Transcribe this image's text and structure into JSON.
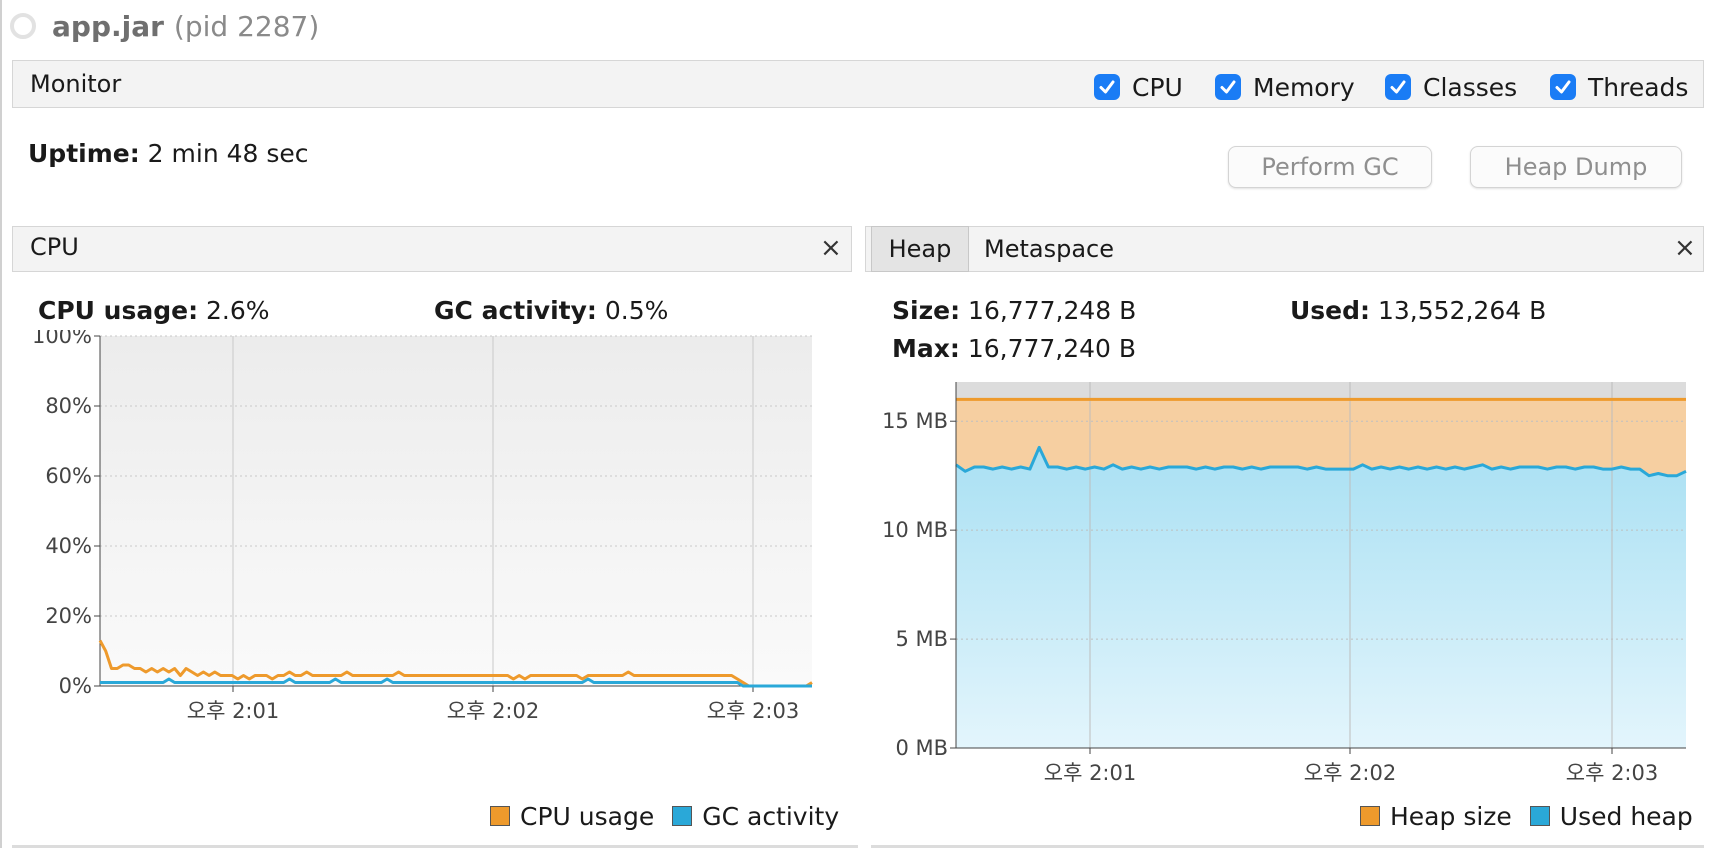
{
  "window": {
    "app_name": "app.jar",
    "pid_text": "(pid 2287)"
  },
  "monitor": {
    "title": "Monitor",
    "checkboxes": [
      {
        "label": "CPU",
        "checked": true
      },
      {
        "label": "Memory",
        "checked": true
      },
      {
        "label": "Classes",
        "checked": true
      },
      {
        "label": "Threads",
        "checked": true
      }
    ],
    "uptime_label": "Uptime:",
    "uptime_value": "2 min 48 sec",
    "perform_gc_label": "Perform GC",
    "heap_dump_label": "Heap Dump"
  },
  "cpu_panel": {
    "title": "CPU",
    "close": "×",
    "cpu_usage_label": "CPU usage:",
    "cpu_usage_value": "2.6%",
    "gc_activity_label": "GC activity:",
    "gc_activity_value": "0.5%",
    "legend": {
      "cpu": "CPU usage",
      "gc": "GC activity"
    }
  },
  "memory_panel": {
    "tabs": [
      "Heap",
      "Metaspace"
    ],
    "close": "×",
    "size_label": "Size:",
    "size_value": "16,777,248 B",
    "used_label": "Used:",
    "used_value": "13,552,264 B",
    "max_label": "Max:",
    "max_value": "16,777,240 B",
    "legend": {
      "heap_size": "Heap size",
      "used_heap": "Used heap"
    }
  },
  "colors": {
    "orange": "#ee9a2c",
    "blue": "#2aa8d8",
    "checkbox": "#1a7cf5"
  },
  "chart_data": [
    {
      "type": "line",
      "name": "CPU",
      "x_tick_labels": [
        "오후 2:01",
        "오후 2:02",
        "오후 2:03"
      ],
      "y_tick_labels": [
        "0%",
        "20%",
        "40%",
        "60%",
        "80%",
        "100%"
      ],
      "ylim": [
        0,
        100
      ],
      "grid": true,
      "legend_position": "bottom-right",
      "series": [
        {
          "name": "CPU usage",
          "color": "#ee9a2c",
          "values": [
            13,
            10,
            5,
            5,
            6,
            6,
            5,
            5,
            4,
            5,
            4,
            5,
            4,
            5,
            3,
            5,
            4,
            3,
            4,
            3,
            4,
            3,
            3,
            3,
            2,
            3,
            2,
            3,
            3,
            3,
            2,
            3,
            3,
            4,
            3,
            3,
            4,
            3,
            3,
            3,
            3,
            3,
            3,
            4,
            3,
            3,
            3,
            3,
            3,
            3,
            3,
            3,
            4,
            3,
            3,
            3,
            3,
            3,
            3,
            3,
            3,
            3,
            3,
            3,
            3,
            3,
            3,
            3,
            3,
            3,
            3,
            3,
            2,
            3,
            2,
            3,
            3,
            3,
            3,
            3,
            3,
            3,
            3,
            3,
            2,
            3,
            3,
            3,
            3,
            3,
            3,
            3,
            4,
            3,
            3,
            3,
            3,
            3,
            3,
            3,
            3,
            3,
            3,
            3,
            3,
            3,
            3,
            3,
            3,
            3,
            3,
            2,
            1,
            0,
            0,
            0,
            0,
            0,
            0,
            0,
            0,
            0,
            0,
            0,
            1
          ]
        },
        {
          "name": "GC activity",
          "color": "#2aa8d8",
          "values": [
            1,
            1,
            1,
            1,
            1,
            1,
            1,
            1,
            1,
            1,
            1,
            1,
            2,
            1,
            1,
            1,
            1,
            1,
            1,
            1,
            1,
            1,
            1,
            1,
            1,
            1,
            1,
            1,
            1,
            1,
            1,
            1,
            1,
            2,
            1,
            1,
            1,
            1,
            1,
            1,
            1,
            2,
            1,
            1,
            1,
            1,
            1,
            1,
            1,
            1,
            2,
            1,
            1,
            1,
            1,
            1,
            1,
            1,
            1,
            1,
            1,
            1,
            1,
            1,
            1,
            1,
            1,
            1,
            1,
            1,
            1,
            1,
            1,
            1,
            1,
            1,
            1,
            1,
            1,
            1,
            1,
            1,
            1,
            1,
            1,
            2,
            1,
            1,
            1,
            1,
            1,
            1,
            1,
            1,
            1,
            1,
            1,
            1,
            1,
            1,
            1,
            1,
            1,
            1,
            1,
            1,
            1,
            1,
            1,
            1,
            1,
            1,
            0,
            0,
            0,
            0,
            0,
            0,
            0,
            0,
            0,
            0,
            0,
            0,
            0
          ]
        }
      ]
    },
    {
      "type": "area",
      "name": "Heap",
      "x_tick_labels": [
        "오후 2:01",
        "오후 2:02",
        "오후 2:03"
      ],
      "y_tick_labels": [
        "0 MB",
        "5 MB",
        "10 MB",
        "15 MB"
      ],
      "ylim": [
        0,
        16.8
      ],
      "grid": true,
      "legend_position": "bottom-right",
      "series": [
        {
          "name": "Heap size",
          "color": "#ee9a2c",
          "values": [
            16,
            16,
            16,
            16,
            16,
            16,
            16,
            16,
            16,
            16,
            16,
            16,
            16,
            16,
            16,
            16,
            16,
            16,
            16,
            16,
            16,
            16,
            16,
            16,
            16,
            16,
            16,
            16,
            16,
            16,
            16,
            16,
            16,
            16,
            16,
            16,
            16,
            16,
            16,
            16,
            16,
            16,
            16,
            16,
            16,
            16,
            16,
            16,
            16,
            16,
            16,
            16,
            16,
            16,
            16,
            16,
            16,
            16,
            16,
            16,
            16,
            16,
            16,
            16,
            16,
            16,
            16,
            16,
            16,
            16,
            16,
            16,
            16,
            16,
            16,
            16,
            16,
            16,
            16,
            16
          ]
        },
        {
          "name": "Used heap",
          "color": "#2aa8d8",
          "values": [
            13.0,
            12.7,
            12.9,
            12.9,
            12.8,
            12.9,
            12.8,
            12.9,
            12.8,
            13.8,
            12.9,
            12.9,
            12.8,
            12.9,
            12.8,
            12.9,
            12.8,
            13.0,
            12.8,
            12.9,
            12.8,
            12.9,
            12.8,
            12.9,
            12.9,
            12.9,
            12.8,
            12.9,
            12.8,
            12.9,
            12.9,
            12.8,
            12.9,
            12.8,
            12.9,
            12.9,
            12.9,
            12.9,
            12.8,
            12.9,
            12.8,
            12.8,
            12.8,
            12.8,
            13.0,
            12.8,
            12.9,
            12.8,
            12.9,
            12.8,
            12.9,
            12.8,
            12.9,
            12.8,
            12.9,
            12.8,
            12.9,
            13.0,
            12.8,
            12.9,
            12.8,
            12.9,
            12.9,
            12.9,
            12.8,
            12.9,
            12.9,
            12.8,
            12.9,
            12.9,
            12.8,
            12.8,
            12.9,
            12.8,
            12.8,
            12.5,
            12.6,
            12.5,
            12.5,
            12.7
          ]
        }
      ]
    }
  ]
}
